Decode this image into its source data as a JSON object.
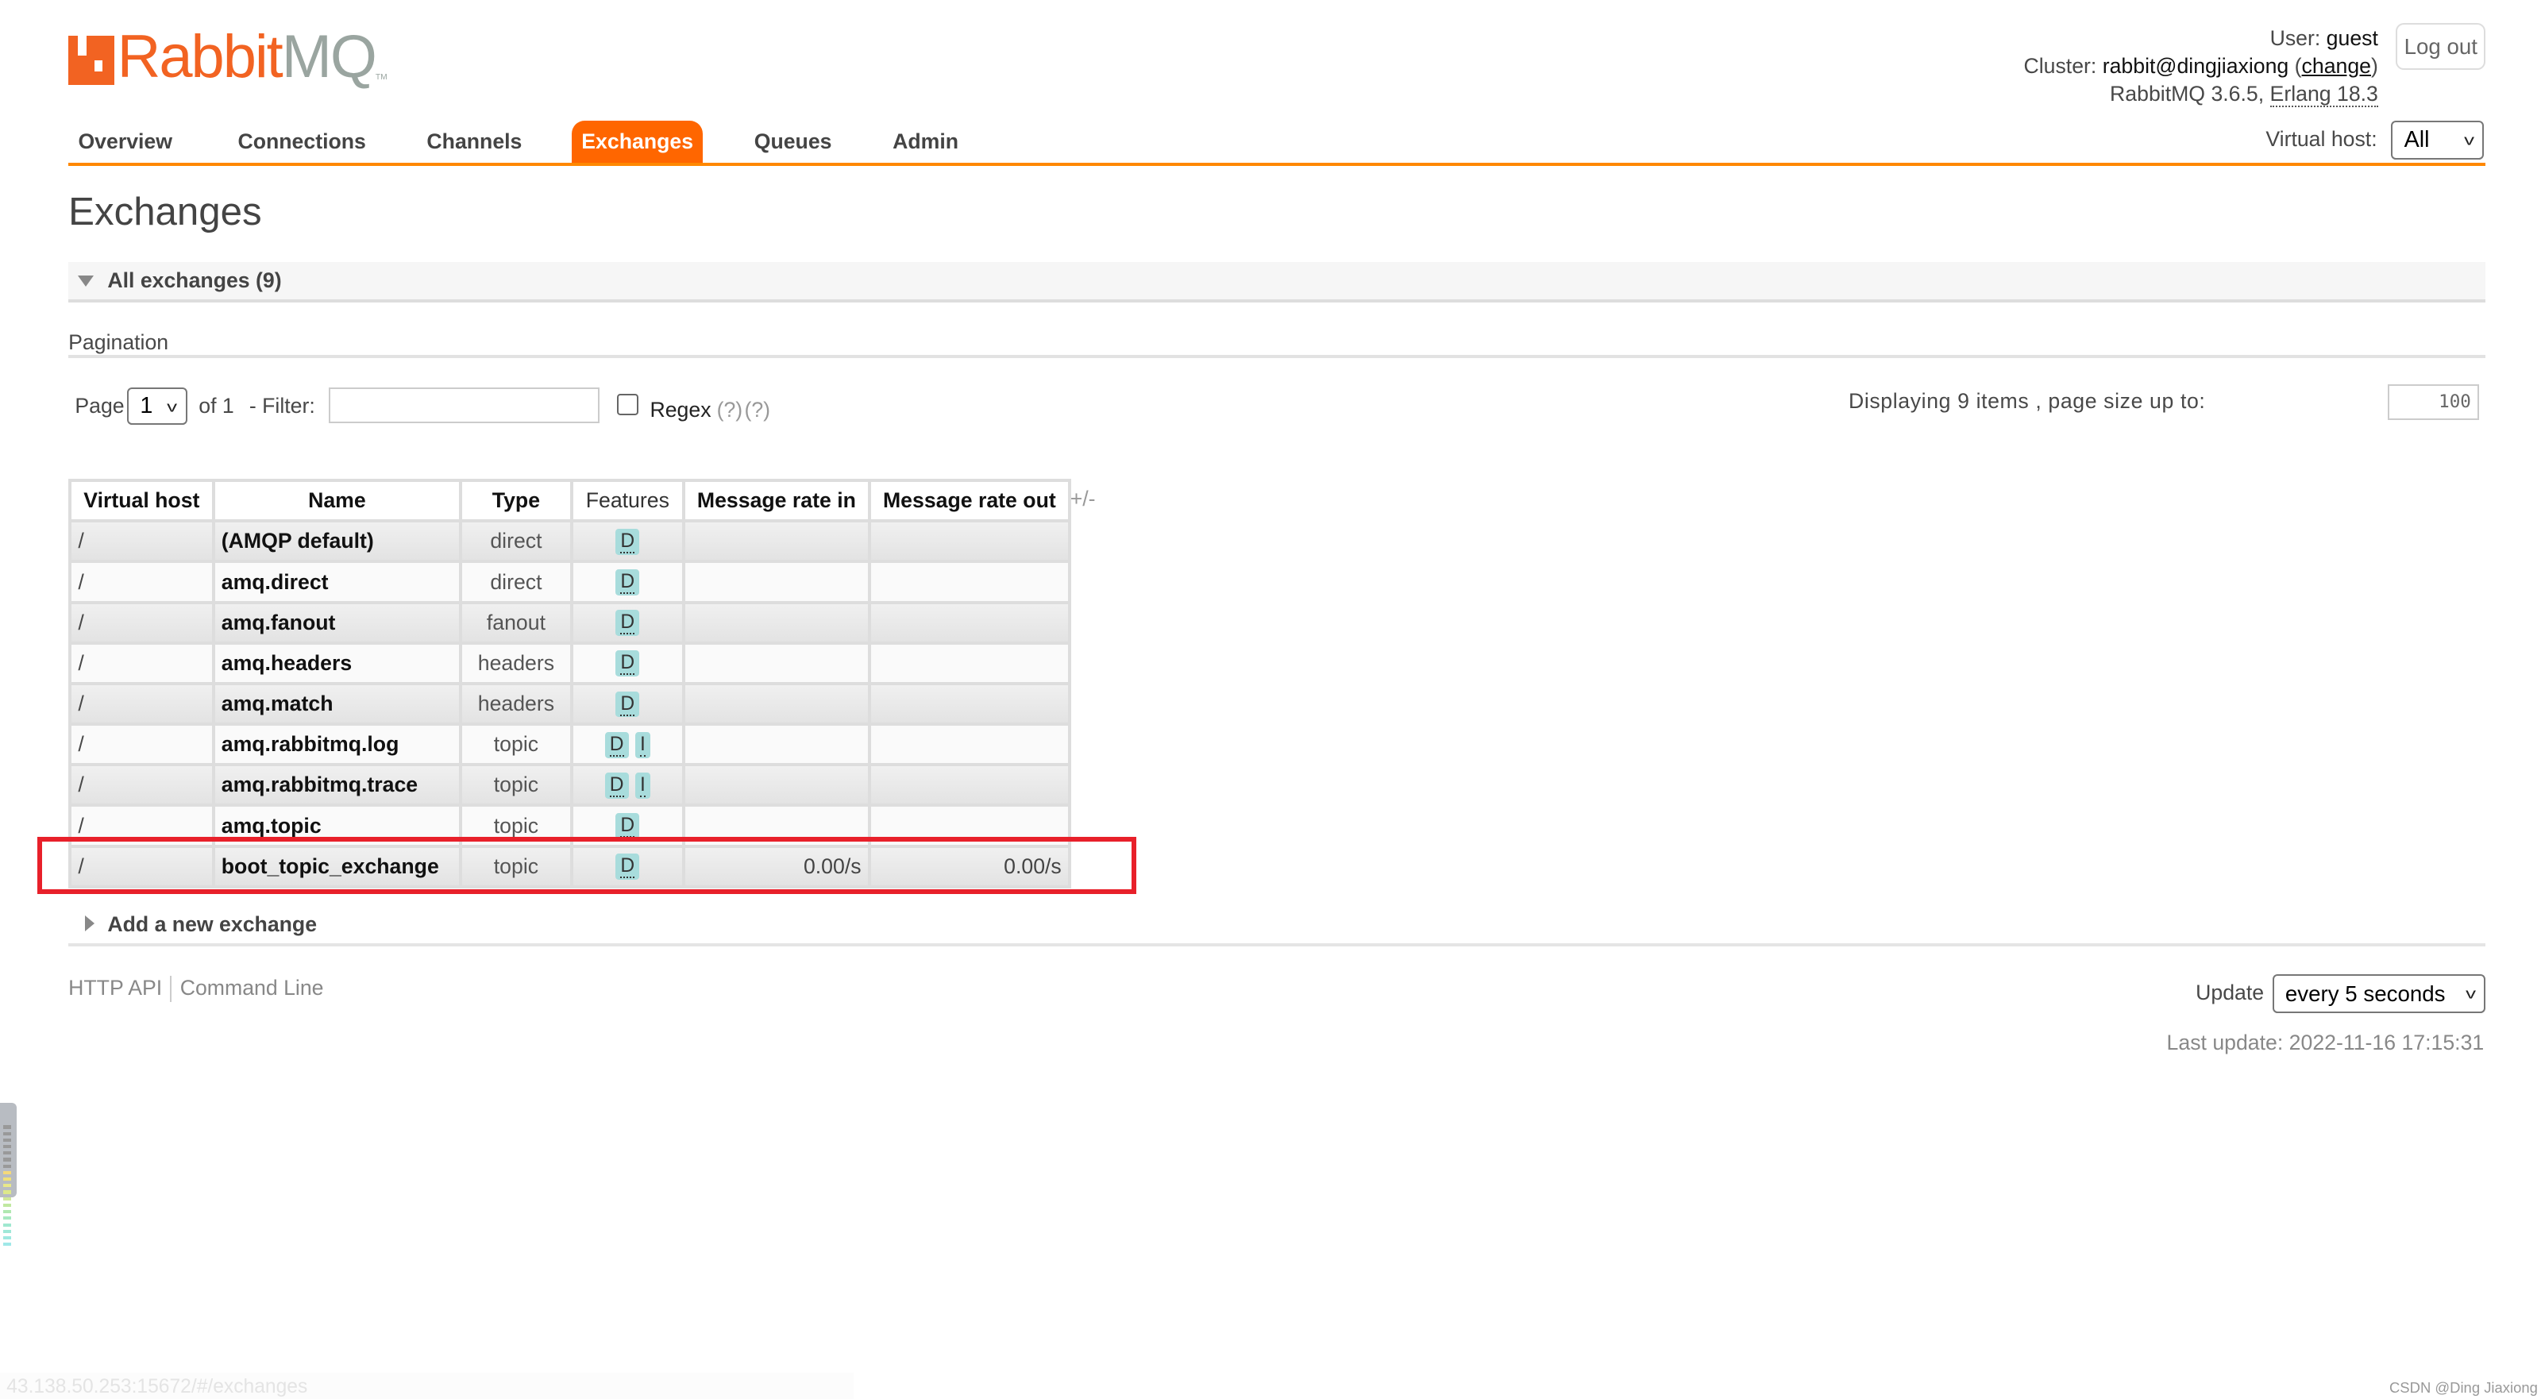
{
  "logo": {
    "text_primary": "Rabbit",
    "text_secondary": "MQ",
    "tm": "TM"
  },
  "nav": {
    "tabs": [
      {
        "label": "Overview"
      },
      {
        "label": "Connections"
      },
      {
        "label": "Channels"
      },
      {
        "label": "Exchanges",
        "active": true
      },
      {
        "label": "Queues"
      },
      {
        "label": "Admin"
      }
    ]
  },
  "user": {
    "user_label": "User:",
    "user": "guest",
    "cluster_label": "Cluster:",
    "cluster": "rabbit@dingjiaxiong",
    "change_open": "(",
    "change_link": "change",
    "change_close": ")",
    "version": "RabbitMQ 3.6.5,",
    "erlang": "Erlang 18.3",
    "logout": "Log out"
  },
  "vhost": {
    "label": "Virtual host:",
    "selected": "All"
  },
  "page_title": "Exchanges",
  "section": {
    "title": "All exchanges (9)"
  },
  "pagination": {
    "title": "Pagination",
    "page_label": "Page",
    "page_selected": "1",
    "of_label": "of 1",
    "filter_label": "- Filter:",
    "filter_value": "",
    "regex_label": "Regex",
    "help1": "(?)",
    "help2": "(?)",
    "displaying": "Displaying 9 items , page size up to:",
    "page_size": "100"
  },
  "table": {
    "headers": [
      "Virtual host",
      "Name",
      "Type",
      "Features",
      "Message rate in",
      "Message rate out"
    ],
    "toggle_columns": "+/-",
    "rows": [
      {
        "vhost": "/",
        "name": "(AMQP default)",
        "type": "direct",
        "features": [
          "D"
        ],
        "rate_in": "",
        "rate_out": ""
      },
      {
        "vhost": "/",
        "name": "amq.direct",
        "type": "direct",
        "features": [
          "D"
        ],
        "rate_in": "",
        "rate_out": ""
      },
      {
        "vhost": "/",
        "name": "amq.fanout",
        "type": "fanout",
        "features": [
          "D"
        ],
        "rate_in": "",
        "rate_out": ""
      },
      {
        "vhost": "/",
        "name": "amq.headers",
        "type": "headers",
        "features": [
          "D"
        ],
        "rate_in": "",
        "rate_out": ""
      },
      {
        "vhost": "/",
        "name": "amq.match",
        "type": "headers",
        "features": [
          "D"
        ],
        "rate_in": "",
        "rate_out": ""
      },
      {
        "vhost": "/",
        "name": "amq.rabbitmq.log",
        "type": "topic",
        "features": [
          "D",
          "I"
        ],
        "rate_in": "",
        "rate_out": ""
      },
      {
        "vhost": "/",
        "name": "amq.rabbitmq.trace",
        "type": "topic",
        "features": [
          "D",
          "I"
        ],
        "rate_in": "",
        "rate_out": ""
      },
      {
        "vhost": "/",
        "name": "amq.topic",
        "type": "topic",
        "features": [
          "D"
        ],
        "rate_in": "",
        "rate_out": ""
      },
      {
        "vhost": "/",
        "name": "boot_topic_exchange",
        "type": "topic",
        "features": [
          "D"
        ],
        "rate_in": "0.00/s",
        "rate_out": "0.00/s",
        "highlighted": true
      }
    ]
  },
  "add_exchange": "Add a new exchange",
  "footer": {
    "http_api": "HTTP API",
    "command_line": "Command Line",
    "update_label": "Update",
    "update_selected": "every 5 seconds",
    "last_update": "Last update: 2022-11-16 17:15:31"
  },
  "status_url": "43.138.50.253:15672/#/exchanges",
  "watermark": "CSDN @Ding Jiaxiong",
  "colors": {
    "accent": "#ff6600",
    "nav_underline": "#ff8800",
    "highlight_box": "#e8202a",
    "feature_badge": "#a8dcdc"
  }
}
